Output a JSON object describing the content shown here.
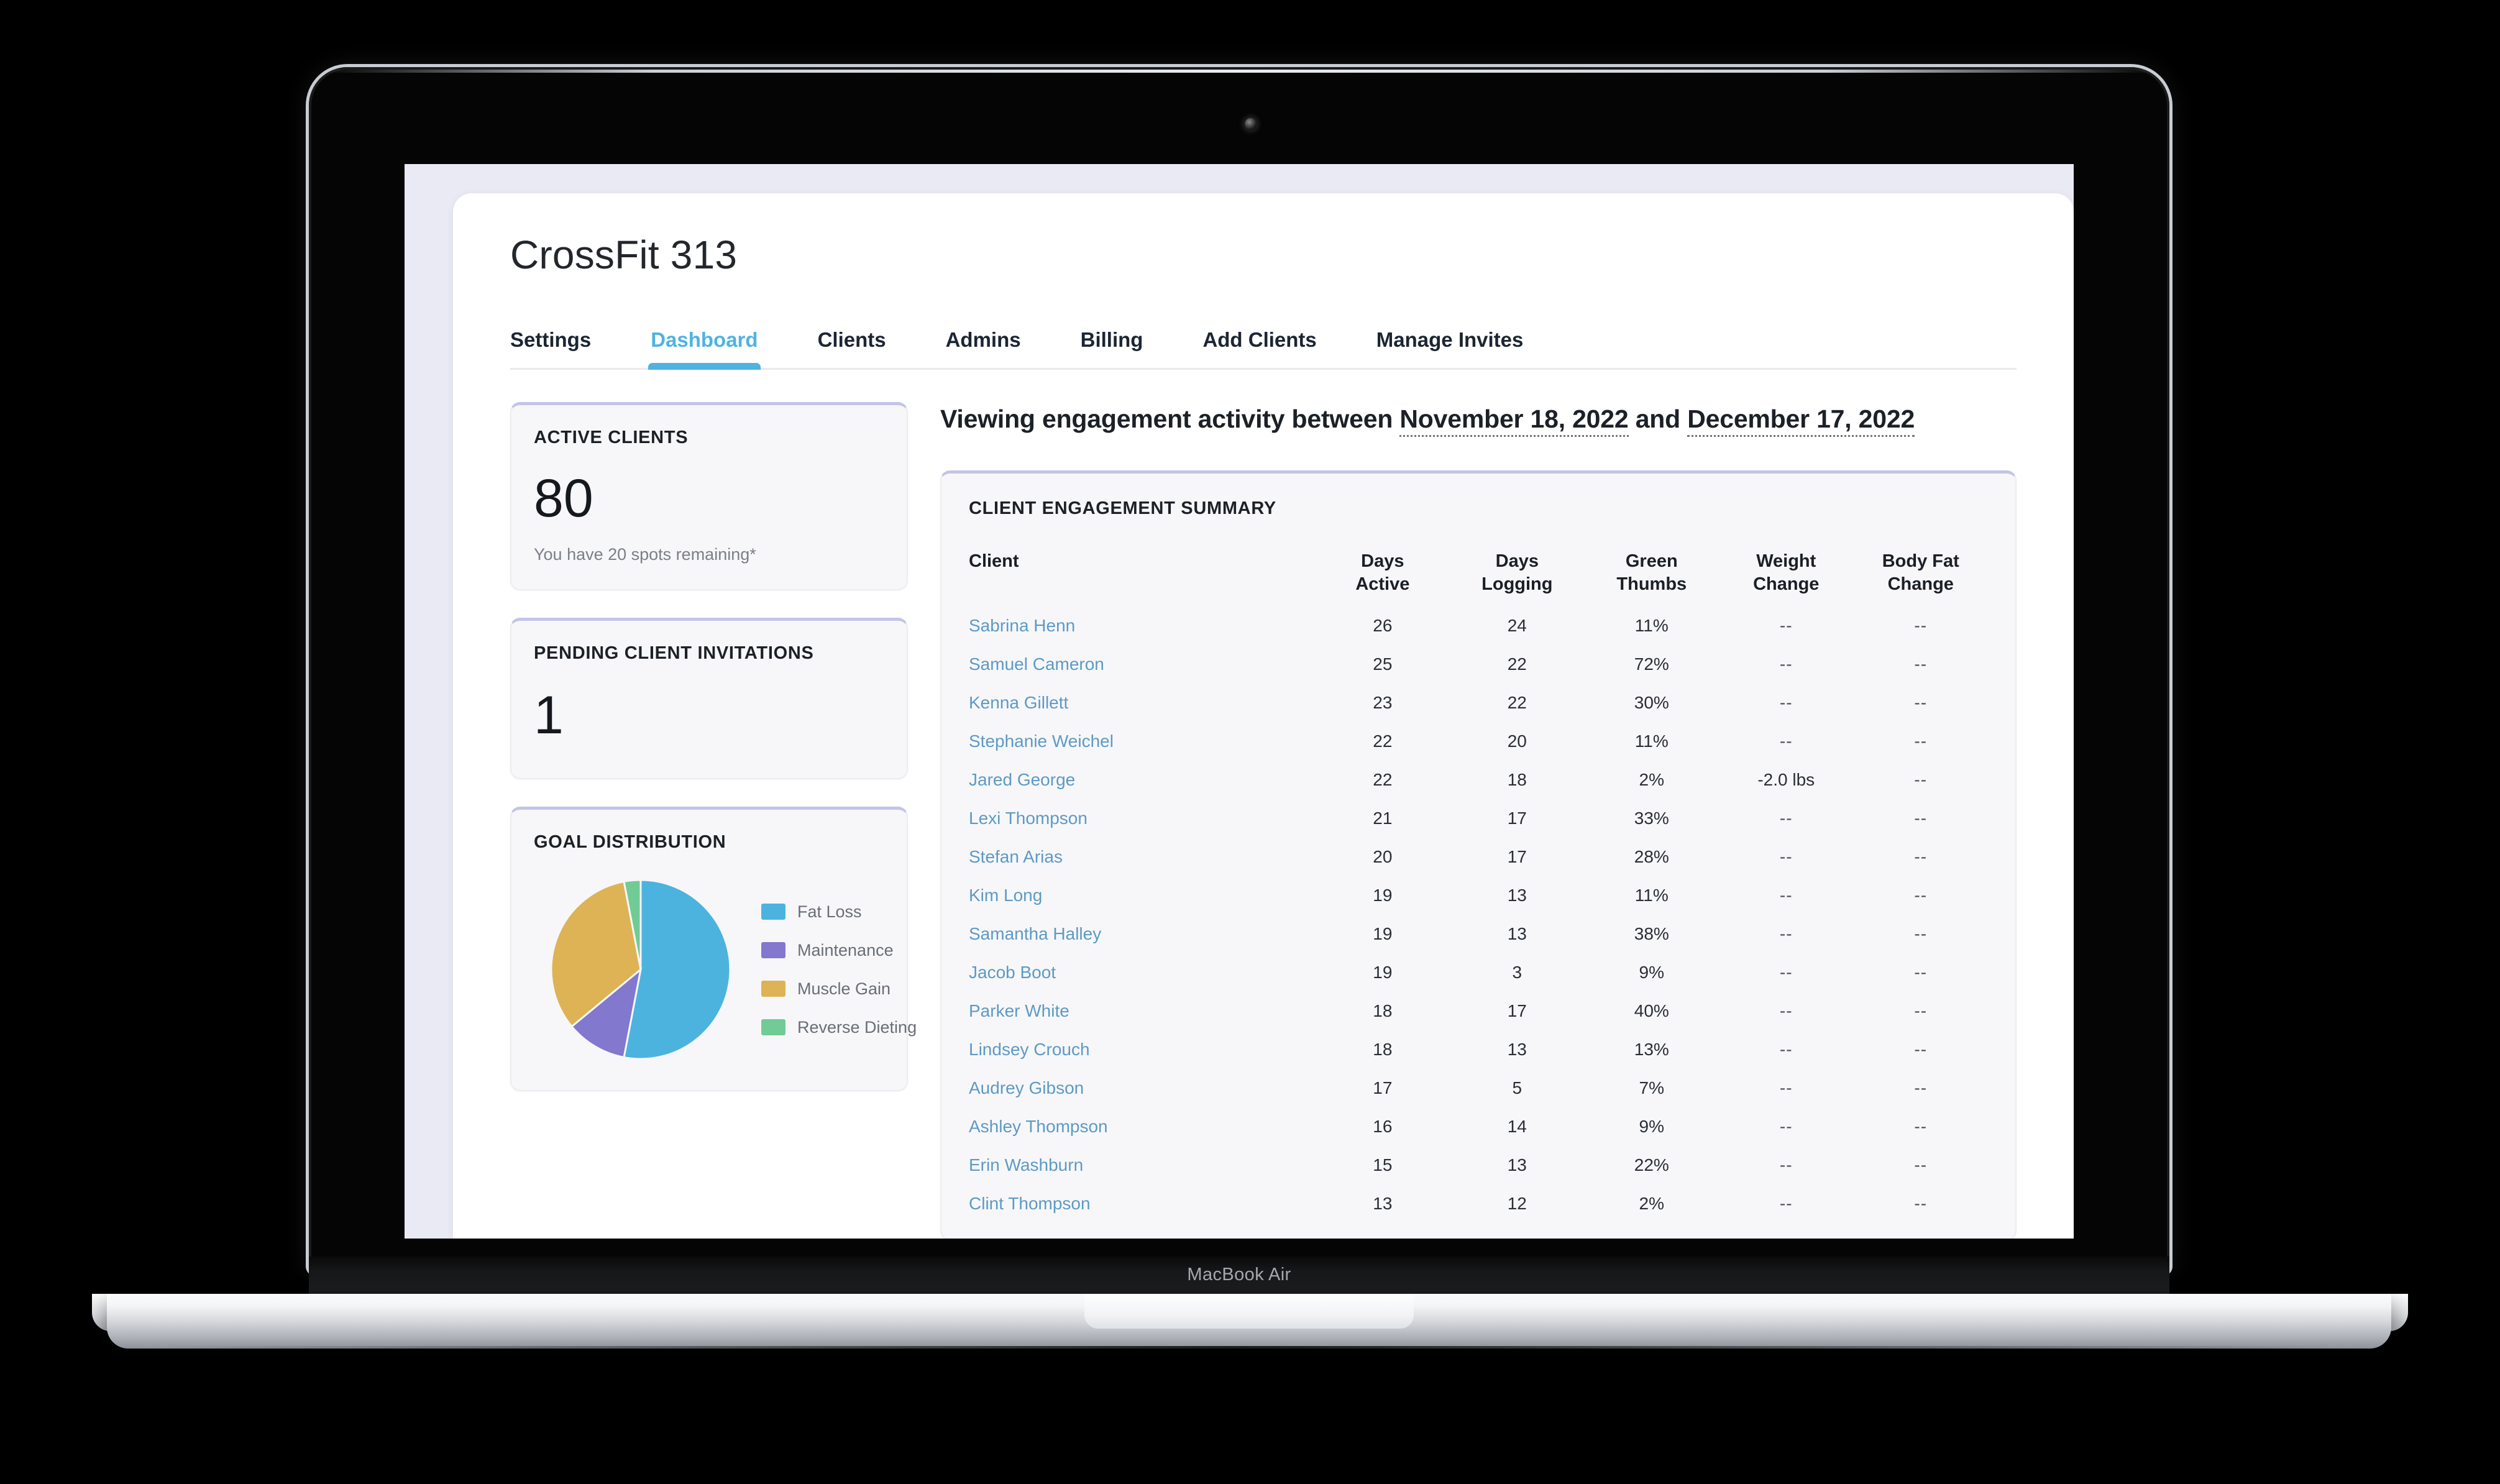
{
  "device": {
    "model_label": "MacBook Air"
  },
  "app": {
    "brand_title": "CrossFit 313",
    "tabs": [
      {
        "label": "Settings",
        "active": false
      },
      {
        "label": "Dashboard",
        "active": true
      },
      {
        "label": "Clients",
        "active": false
      },
      {
        "label": "Admins",
        "active": false
      },
      {
        "label": "Billing",
        "active": false
      },
      {
        "label": "Add Clients",
        "active": false
      },
      {
        "label": "Manage Invites",
        "active": false
      }
    ]
  },
  "sidebar": {
    "active_clients": {
      "label": "ACTIVE CLIENTS",
      "value": "80",
      "sub": "You have 20 spots remaining*"
    },
    "pending_invitations": {
      "label": "PENDING CLIENT INVITATIONS",
      "value": "1"
    },
    "goal_distribution": {
      "label": "GOAL DISTRIBUTION"
    }
  },
  "range": {
    "prefix": "Viewing engagement activity between",
    "start_date": "November 18, 2022",
    "joiner": "and",
    "end_date": "December 17, 2022"
  },
  "summary": {
    "title": "CLIENT ENGAGEMENT SUMMARY",
    "columns": [
      {
        "key": "client",
        "line1": "Client",
        "line2": ""
      },
      {
        "key": "days_active",
        "line1": "Days",
        "line2": "Active"
      },
      {
        "key": "days_logging",
        "line1": "Days",
        "line2": "Logging"
      },
      {
        "key": "green_thumbs",
        "line1": "Green",
        "line2": "Thumbs"
      },
      {
        "key": "weight_change",
        "line1": "Weight",
        "line2": "Change"
      },
      {
        "key": "body_fat_change",
        "line1": "Body Fat",
        "line2": "Change"
      }
    ],
    "rows": [
      {
        "client": "Sabrina Henn",
        "days_active": "26",
        "days_logging": "24",
        "green_thumbs": "11%",
        "weight_change": "--",
        "body_fat_change": "--"
      },
      {
        "client": "Samuel Cameron",
        "days_active": "25",
        "days_logging": "22",
        "green_thumbs": "72%",
        "weight_change": "--",
        "body_fat_change": "--"
      },
      {
        "client": "Kenna Gillett",
        "days_active": "23",
        "days_logging": "22",
        "green_thumbs": "30%",
        "weight_change": "--",
        "body_fat_change": "--"
      },
      {
        "client": "Stephanie Weichel",
        "days_active": "22",
        "days_logging": "20",
        "green_thumbs": "11%",
        "weight_change": "--",
        "body_fat_change": "--"
      },
      {
        "client": "Jared George",
        "days_active": "22",
        "days_logging": "18",
        "green_thumbs": "2%",
        "weight_change": "-2.0 lbs",
        "body_fat_change": "--"
      },
      {
        "client": "Lexi Thompson",
        "days_active": "21",
        "days_logging": "17",
        "green_thumbs": "33%",
        "weight_change": "--",
        "body_fat_change": "--"
      },
      {
        "client": "Stefan Arias",
        "days_active": "20",
        "days_logging": "17",
        "green_thumbs": "28%",
        "weight_change": "--",
        "body_fat_change": "--"
      },
      {
        "client": "Kim Long",
        "days_active": "19",
        "days_logging": "13",
        "green_thumbs": "11%",
        "weight_change": "--",
        "body_fat_change": "--"
      },
      {
        "client": "Samantha Halley",
        "days_active": "19",
        "days_logging": "13",
        "green_thumbs": "38%",
        "weight_change": "--",
        "body_fat_change": "--"
      },
      {
        "client": "Jacob Boot",
        "days_active": "19",
        "days_logging": "3",
        "green_thumbs": "9%",
        "weight_change": "--",
        "body_fat_change": "--"
      },
      {
        "client": "Parker White",
        "days_active": "18",
        "days_logging": "17",
        "green_thumbs": "40%",
        "weight_change": "--",
        "body_fat_change": "--"
      },
      {
        "client": "Lindsey Crouch",
        "days_active": "18",
        "days_logging": "13",
        "green_thumbs": "13%",
        "weight_change": "--",
        "body_fat_change": "--"
      },
      {
        "client": "Audrey Gibson",
        "days_active": "17",
        "days_logging": "5",
        "green_thumbs": "7%",
        "weight_change": "--",
        "body_fat_change": "--"
      },
      {
        "client": "Ashley Thompson",
        "days_active": "16",
        "days_logging": "14",
        "green_thumbs": "9%",
        "weight_change": "--",
        "body_fat_change": "--"
      },
      {
        "client": "Erin Washburn",
        "days_active": "15",
        "days_logging": "13",
        "green_thumbs": "22%",
        "weight_change": "--",
        "body_fat_change": "--"
      },
      {
        "client": "Clint Thompson",
        "days_active": "13",
        "days_logging": "12",
        "green_thumbs": "2%",
        "weight_change": "--",
        "body_fat_change": "--"
      }
    ]
  },
  "chart_data": {
    "type": "pie",
    "title": "GOAL DISTRIBUTION",
    "labels": [
      "Fat Loss",
      "Maintenance",
      "Muscle Gain",
      "Reverse Dieting"
    ],
    "values": [
      53,
      11,
      33,
      3
    ],
    "colors": [
      "#4cb3df",
      "#8278ce",
      "#ddb355",
      "#71cb96"
    ],
    "legend_position": "right",
    "start_angle_deg": 0,
    "direction": "clockwise"
  },
  "theme": {
    "accent": "#4fb3e0",
    "card_top_border": "#c3c4e8",
    "page_bg": "#e9eaf4",
    "link": "#5d9ac5",
    "text": "#1c2027"
  }
}
